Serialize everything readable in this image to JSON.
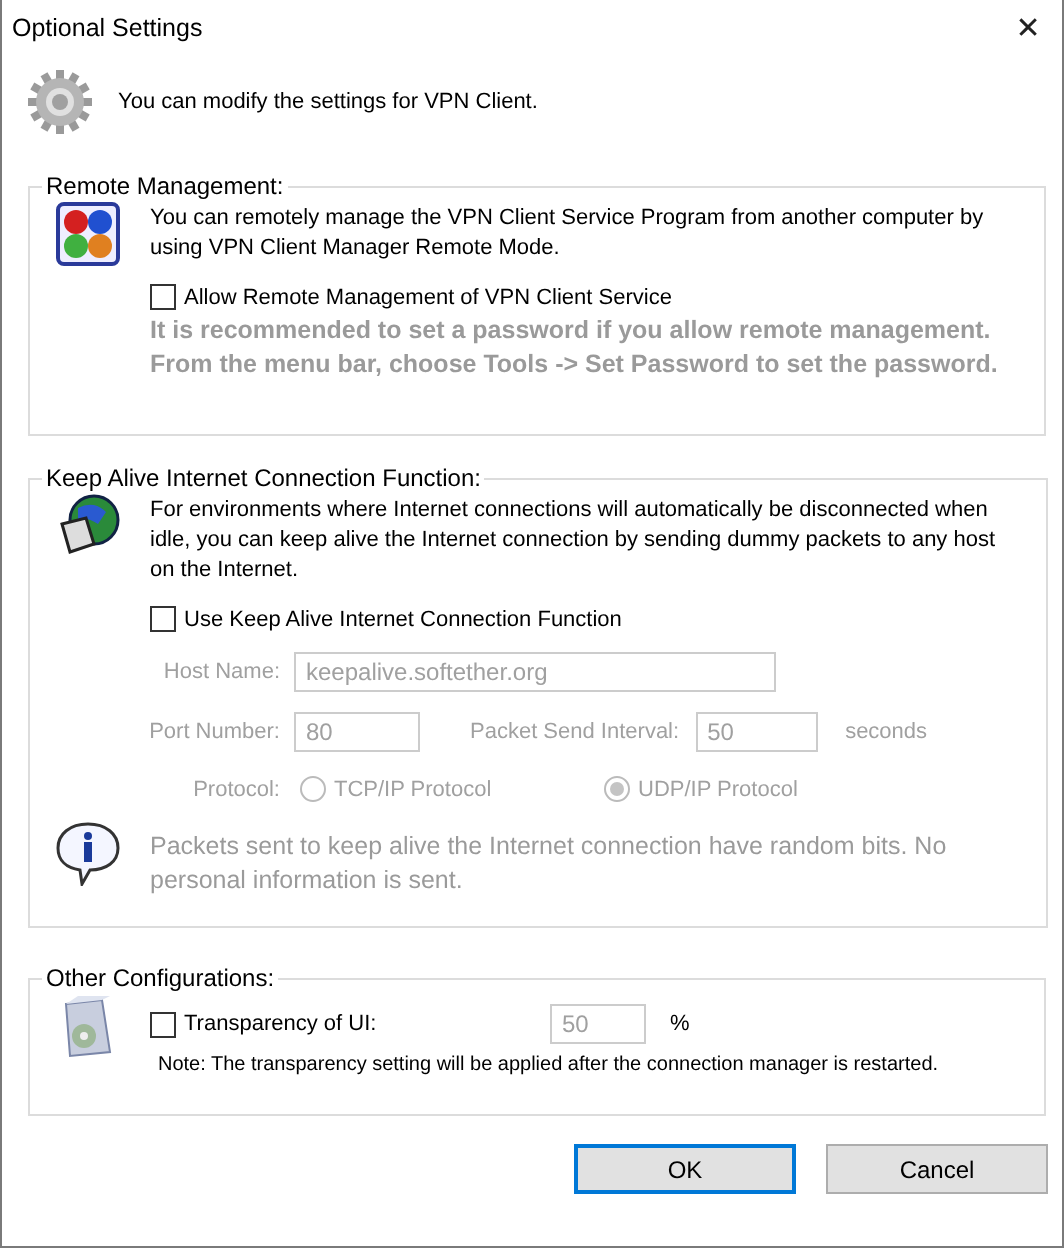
{
  "window": {
    "title": "Optional Settings",
    "close": "✕"
  },
  "header": {
    "text": "You can modify the settings for VPN Client."
  },
  "remote_management": {
    "title": "Remote Management:",
    "description": "You can remotely manage the VPN Client Service Program from another computer by using VPN Client Manager Remote Mode.",
    "checkbox": {
      "label": "Allow Remote Management of VPN Client Service",
      "checked": false
    },
    "warning": "It is recommended to set a password if you allow remote management. From the menu bar, choose Tools -> Set Password to set the password."
  },
  "keep_alive": {
    "title": "Keep Alive Internet Connection Function:",
    "description": "For environments where Internet connections will automatically be disconnected when idle, you can keep alive the Internet connection by sending dummy packets to any host on the Internet.",
    "checkbox": {
      "label": "Use Keep Alive Internet Connection Function",
      "checked": false
    },
    "host": {
      "label": "Host Name:",
      "value": "keepalive.softether.org",
      "disabled": true
    },
    "port": {
      "label": "Port Number:",
      "value": "80",
      "disabled": true
    },
    "interval": {
      "label": "Packet Send Interval:",
      "value": "50",
      "unit": "seconds",
      "disabled": true
    },
    "protocol": {
      "label": "Protocol:",
      "disabled": true,
      "options": [
        {
          "label": "TCP/IP Protocol",
          "selected": false
        },
        {
          "label": "UDP/IP Protocol",
          "selected": true
        }
      ]
    },
    "info": "Packets sent to keep alive the Internet connection have random bits. No personal information is sent."
  },
  "other": {
    "title": "Other Configurations:",
    "checkbox": {
      "label": "Transparency of UI:",
      "checked": false
    },
    "transparency": {
      "value": "50",
      "unit": "%",
      "disabled": true
    },
    "note": "Note: The transparency setting will be applied after the connection manager is restarted."
  },
  "buttons": [
    {
      "label": "OK",
      "default": true
    },
    {
      "label": "Cancel",
      "default": false
    }
  ]
}
